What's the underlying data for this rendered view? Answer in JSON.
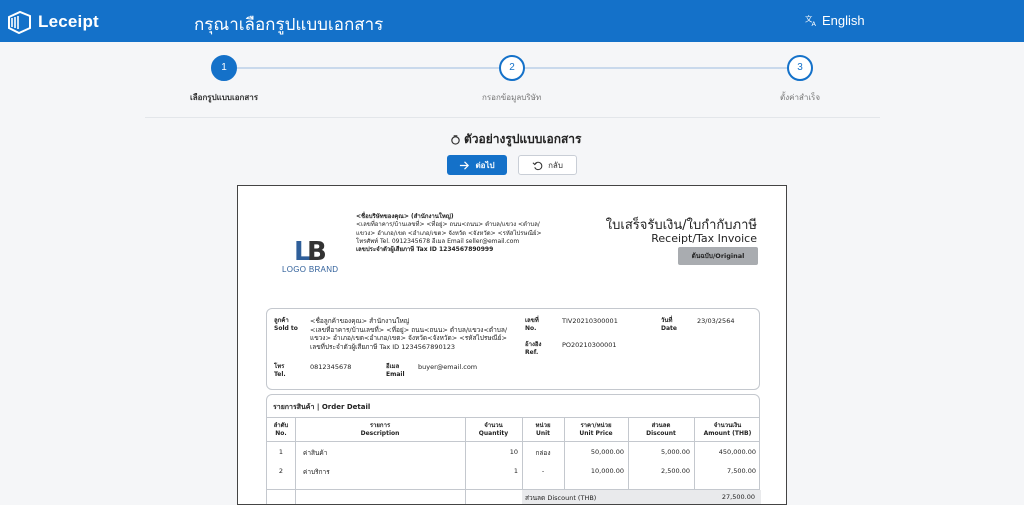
{
  "header": {
    "logo_text": "Leceipt",
    "page_title": "กรุณาเลือกรูปแบบเอกสาร",
    "language": "English",
    "brand_color": "#1471c9"
  },
  "stepper": {
    "steps": [
      {
        "number": "1",
        "label": "เลือกรูปแบบเอกสาร",
        "active": true
      },
      {
        "number": "2",
        "label": "กรอกข้อมูลบริษัท",
        "active": false
      },
      {
        "number": "3",
        "label": "ตั้งค่าสำเร็จ",
        "active": false
      }
    ]
  },
  "preview": {
    "title": "ตัวอย่างรูปแบบเอกสาร",
    "next_label": "ต่อไป",
    "back_label": "กลับ"
  },
  "document": {
    "brand_logo": "LB",
    "brand_text": "LOGO BRAND",
    "company_name": "<ชื่อบริษัทของคุณ> (สำนักงานใหญ่)",
    "company_address_1": "<เลขที่อาคาร/บ้านเลขที่> <ที่อยู่> ถนน<ถนน> ตำบล/แขวง <ตำบล/",
    "company_address_2": "แขวง> อำเภอ/เขต <อำเภอ/เขต> จังหวัด <จังหวัด> <รหัสไปรษณีย์>",
    "company_contact": "โทรศัพท์ Tel. 0912345678  อีเมล Email seller@email.com",
    "company_tax": "เลขประจำตัวผู้เสียภาษี  Tax ID 1234567890999",
    "title_th": "ใบเสร็จรับเงิน/ใบกำกับภาษี",
    "title_en": "Receipt/Tax Invoice",
    "badge": "ต้นฉบับ/Original",
    "buyer": {
      "sold_to_th": "ลูกค้า",
      "sold_to_en": "Sold to",
      "line1": "<ชื่อลูกค้าของคุณ> สำนักงานใหญ่",
      "line2": "<เลขที่อาคาร/บ้านเลขที่> <ที่อยู่> ถนน<ถนน> ตำบล/แขวง<ตำบล/",
      "line3": "แขวง> อำเภอ/เขต<อำเภอ/เขต> จังหวัด<จังหวัด> <รหัสไปรษณีย์>",
      "line4": "เลขที่ประจำตัวผู้เสียภาษี Tax ID 1234567890123",
      "tel_th": "โทร",
      "tel_en": "Tel.",
      "tel": "0812345678",
      "email_th": "อีเมล",
      "email_en": "Email",
      "email": "buyer@email.com",
      "no_th": "เลขที่",
      "no_en": "No.",
      "no": "TIV20210300001",
      "date_th": "วันที่",
      "date_en": "Date",
      "date": "23/03/2564",
      "ref_th": "อ้างอิง",
      "ref_en": "Ref.",
      "ref": "PO20210300001"
    },
    "order": {
      "title": "รายการสินค้า | Order Detail",
      "headers": [
        {
          "th": "ลำดับ",
          "en": "No."
        },
        {
          "th": "รายการ",
          "en": "Description"
        },
        {
          "th": "จำนวน",
          "en": "Quantity"
        },
        {
          "th": "หน่วย",
          "en": "Unit"
        },
        {
          "th": "ราคา/หน่วย",
          "en": "Unit Price"
        },
        {
          "th": "ส่วนลด",
          "en": "Discount"
        },
        {
          "th": "จำนวนเงิน",
          "en": "Amount (THB)"
        }
      ],
      "rows": [
        {
          "no": "1",
          "desc": "ค่าสินค้า",
          "qty": "10",
          "unit": "กล่อง",
          "price": "50,000.00",
          "discount": "5,000.00",
          "amount": "450,000.00"
        },
        {
          "no": "2",
          "desc": "ค่าบริการ",
          "qty": "1",
          "unit": "-",
          "price": "10,000.00",
          "discount": "2,500.00",
          "amount": "7,500.00"
        }
      ],
      "summary_label": "ส่วนลด Discount (THB)",
      "summary_value": "27,500.00"
    }
  }
}
